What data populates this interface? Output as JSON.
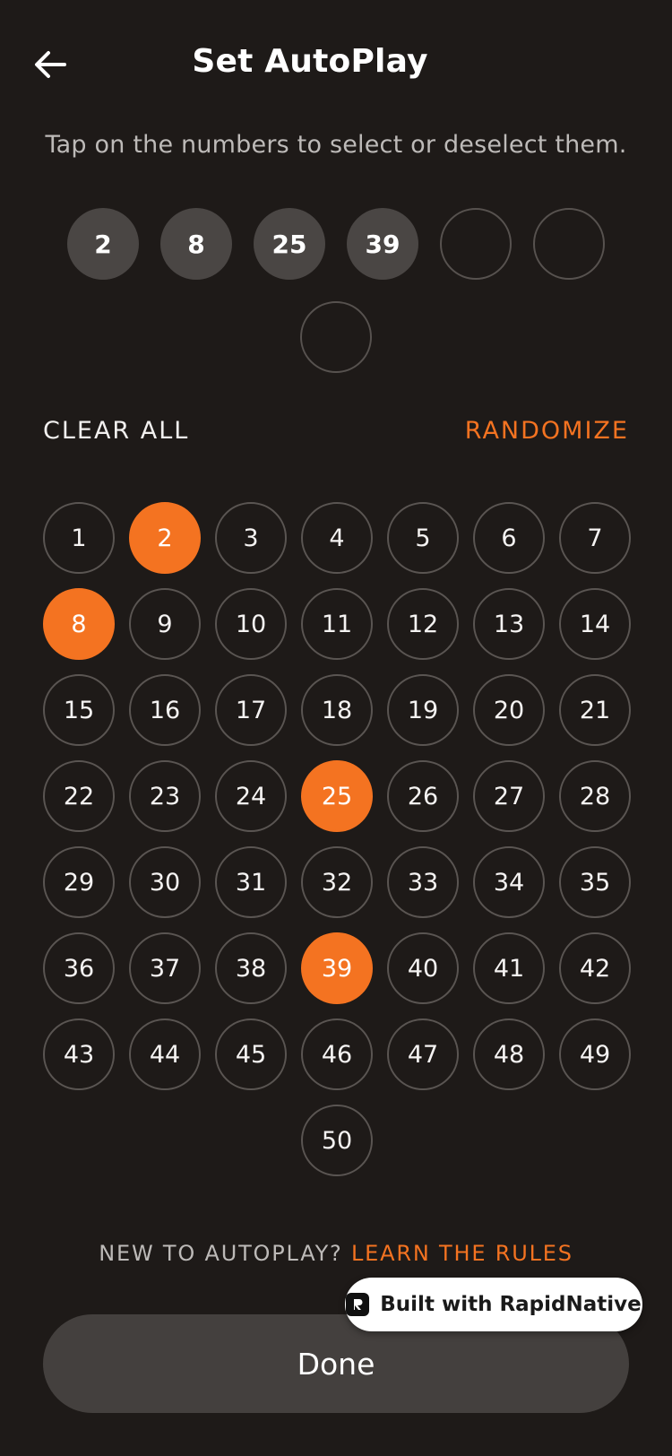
{
  "header": {
    "title": "Set AutoPlay",
    "back_icon": "arrow-left-icon"
  },
  "subtitle": "Tap on the numbers to select or deselect them.",
  "selected_slots": [
    "2",
    "8",
    "25",
    "39",
    "",
    "",
    ""
  ],
  "actions": {
    "clear_all": "CLEAR ALL",
    "randomize": "RANDOMIZE"
  },
  "grid": {
    "numbers": [
      "1",
      "2",
      "3",
      "4",
      "5",
      "6",
      "7",
      "8",
      "9",
      "10",
      "11",
      "12",
      "13",
      "14",
      "15",
      "16",
      "17",
      "18",
      "19",
      "20",
      "21",
      "22",
      "23",
      "24",
      "25",
      "26",
      "27",
      "28",
      "29",
      "30",
      "31",
      "32",
      "33",
      "34",
      "35",
      "36",
      "37",
      "38",
      "39",
      "40",
      "41",
      "42",
      "43",
      "44",
      "45",
      "46",
      "47",
      "48",
      "49",
      "50"
    ],
    "selected": [
      "2",
      "8",
      "25",
      "39"
    ]
  },
  "footer": {
    "question": "NEW TO AUTOPLAY?",
    "link": "LEARN THE RULES",
    "done_label": "Done"
  },
  "badge": {
    "label": "Built with RapidNative",
    "icon": "rapidnative-logo-icon"
  },
  "colors": {
    "background": "#1e1a18",
    "accent": "#f47321",
    "slot_filled": "#4a4644",
    "button": "#44403e"
  }
}
